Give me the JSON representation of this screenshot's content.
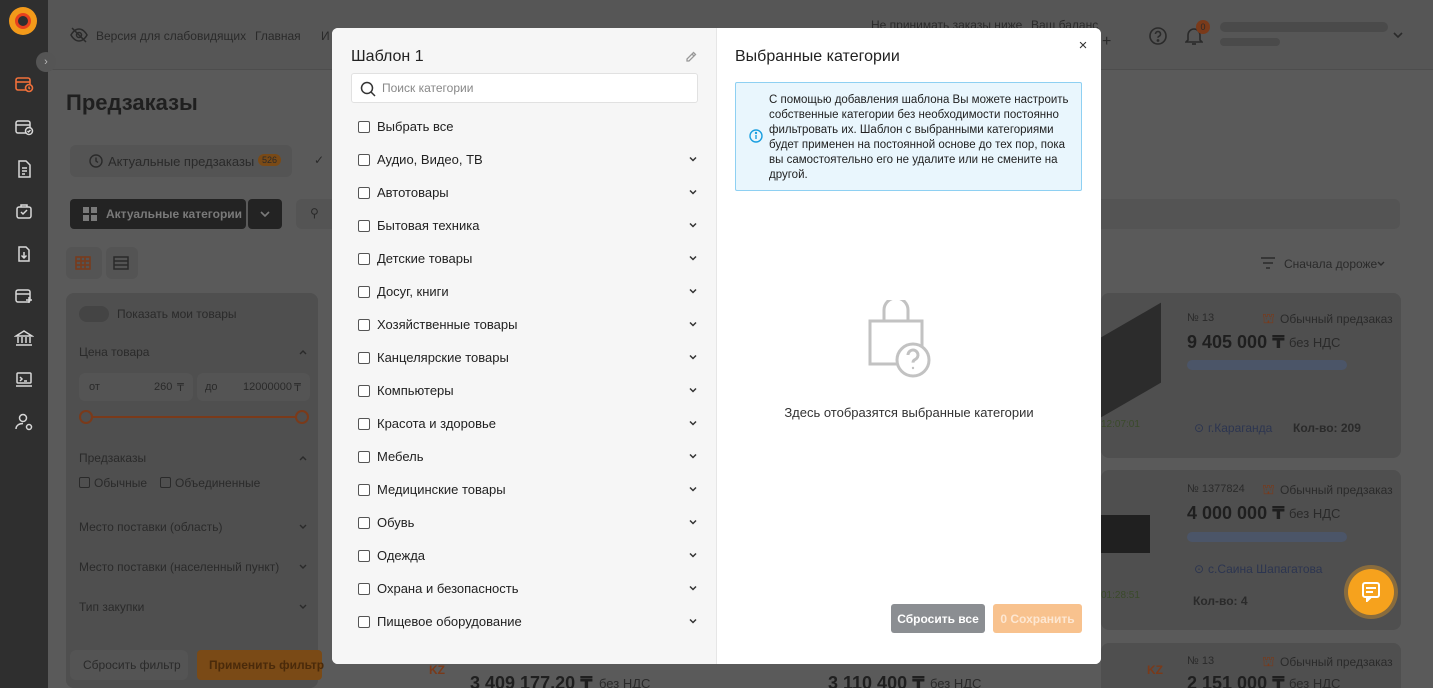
{
  "background": {
    "accessibility_link": "Версия для слабовидящих",
    "nav_home": "Главная",
    "nav_more": "И",
    "top_right_1": "Не принимать заказы ниже",
    "top_right_2": "Ваш баланс",
    "notif_count": "0",
    "page_title": "Предзаказы",
    "tab_actual": "Актуальные предзаказы",
    "tab_actual_count": "526",
    "categories_button": "Актуальные категории",
    "sort_label": "Сначала дороже",
    "show_my_goods": "Показать мои товары",
    "price_label": "Цена товара",
    "price_from_prefix": "от",
    "price_from": "260",
    "price_to_prefix": "до",
    "price_to": "12000000",
    "currency": "₸",
    "preorders_label": "Предзаказы",
    "ordinary": "Обычные",
    "merged": "Объединенные",
    "delivery_region": "Место поставки (область)",
    "delivery_city": "Место поставки (населенный пункт)",
    "purchase_type": "Тип закупки",
    "reset_filter": "Сбросить фильтр",
    "apply_filter": "Применить фильтр",
    "cards": [
      {
        "num": "№ 13",
        "kind": "Обычный предзаказ",
        "price": "9 405 000 ₸",
        "vat": "без НДС",
        "city": "г.Караганда",
        "qty": "Кол-во: 209",
        "time": "12:07:01"
      },
      {
        "num": "№ 1377824",
        "kind": "Обычный предзаказ",
        "price": "4 000 000 ₸",
        "vat": "без НДС",
        "city": "с.Саина Шапагатова",
        "qty": "Кол-во: 4",
        "time": "01:28:51"
      },
      {
        "num": "№ 13",
        "kind": "Обычный предзаказ",
        "price": "2 151 000 ₸",
        "vat": "без НДС"
      }
    ],
    "bottom_prices": [
      "3 409 177,20 ₸",
      "без НДС",
      "3 110 400 ₸",
      "без НДС"
    ],
    "kz_badge": "KZ"
  },
  "modal": {
    "template_title": "Шаблон 1",
    "search_placeholder": "Поиск категории",
    "select_all": "Выбрать все",
    "categories": [
      "Аудио, Видео, ТВ",
      "Автотовары",
      "Бытовая техника",
      "Детские товары",
      "Досуг, книги",
      "Хозяйственные товары",
      "Канцелярские товары",
      "Компьютеры",
      "Красота и здоровье",
      "Мебель",
      "Медицинские товары",
      "Обувь",
      "Одежда",
      "Охрана и безопасность",
      "Пищевое оборудование"
    ],
    "selected_title": "Выбранные категории",
    "close_symbol": "×",
    "info_text": "С помощью добавления шаблона Вы можете настроить собственные категории без необходимости постоянно фильтровать их. Шаблон с выбранными категориями будет применен на постоянной основе до тех пор, пока вы самостоятельно его не удалите или не смените на другой.",
    "empty_text": "Здесь отобразятся выбранные категории",
    "reset_all": "Сбросить все",
    "save": "0 Сохранить"
  },
  "colors": {
    "accent": "#f6a21d",
    "info_bg": "#e9f6fd",
    "info_border": "#8ed0f2"
  }
}
